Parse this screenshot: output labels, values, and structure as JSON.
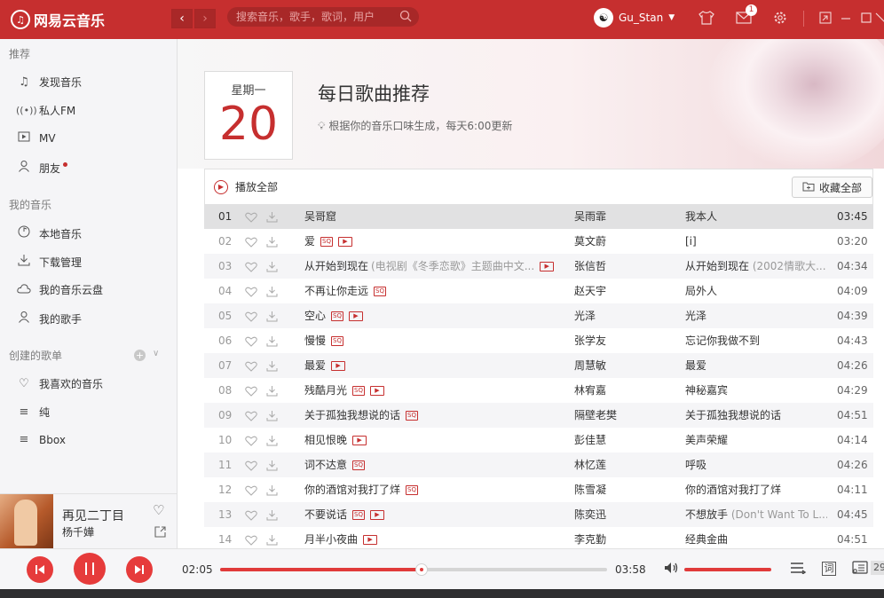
{
  "app": {
    "name": "网易云音乐"
  },
  "search": {
    "placeholder": "搜索音乐，歌手，歌词，用户"
  },
  "user": {
    "name": "Gu_Stan",
    "message_count": "1"
  },
  "sidebar": {
    "sections": [
      {
        "title": "推荐",
        "items": [
          {
            "label": "发现音乐",
            "icon": "music-note-icon"
          },
          {
            "label": "私人FM",
            "icon": "radio-icon"
          },
          {
            "label": "MV",
            "icon": "video-icon"
          },
          {
            "label": "朋友",
            "icon": "friends-icon"
          }
        ]
      },
      {
        "title": "我的音乐",
        "items": [
          {
            "label": "本地音乐",
            "icon": "local-music-icon"
          },
          {
            "label": "下载管理",
            "icon": "download-icon"
          },
          {
            "label": "我的音乐云盘",
            "icon": "cloud-icon"
          },
          {
            "label": "我的歌手",
            "icon": "singer-icon"
          }
        ]
      },
      {
        "title": "创建的歌单",
        "items": [
          {
            "label": "我喜欢的音乐",
            "icon": "heart-icon"
          },
          {
            "label": "纯",
            "icon": "playlist-icon"
          },
          {
            "label": "Bbox",
            "icon": "playlist-icon"
          }
        ]
      }
    ]
  },
  "now_playing": {
    "title": "再见二丁目",
    "artist": "杨千嬅"
  },
  "daily": {
    "weekday": "星期一",
    "day": "20",
    "title": "每日歌曲推荐",
    "subtitle": "根据你的音乐口味生成，每天6:00更新"
  },
  "toolbar": {
    "play_all": "播放全部",
    "collect_all": "收藏全部"
  },
  "tracks": [
    {
      "num": "01",
      "title": "吴哥窟",
      "note": "",
      "sq": false,
      "mv": false,
      "artist": "吴雨霏",
      "album": "我本人",
      "album_note": "",
      "duration": "03:45",
      "selected": true
    },
    {
      "num": "02",
      "title": "爱",
      "note": "",
      "sq": true,
      "mv": true,
      "artist": "莫文蔚",
      "album": "[i]",
      "album_note": "",
      "duration": "03:20"
    },
    {
      "num": "03",
      "title": "从开始到现在",
      "note": "(电视剧《冬季恋歌》主题曲中文...",
      "sq": false,
      "mv": true,
      "artist": "张信哲",
      "album": "从开始到现在",
      "album_note": "(2002情歌大...",
      "duration": "04:34"
    },
    {
      "num": "04",
      "title": "不再让你走远",
      "note": "",
      "sq": true,
      "mv": false,
      "artist": "赵天宇",
      "album": "局外人",
      "album_note": "",
      "duration": "04:09"
    },
    {
      "num": "05",
      "title": "空心",
      "note": "",
      "sq": true,
      "mv": true,
      "artist": "光泽",
      "album": "光泽",
      "album_note": "",
      "duration": "04:39"
    },
    {
      "num": "06",
      "title": "慢慢",
      "note": "",
      "sq": true,
      "mv": false,
      "artist": "张学友",
      "album": "忘记你我做不到",
      "album_note": "",
      "duration": "04:43"
    },
    {
      "num": "07",
      "title": "最爱",
      "note": "",
      "sq": false,
      "mv": true,
      "artist": "周慧敏",
      "album": "最爱",
      "album_note": "",
      "duration": "04:26"
    },
    {
      "num": "08",
      "title": "残酷月光",
      "note": "",
      "sq": true,
      "mv": true,
      "artist": "林宥嘉",
      "album": "神秘嘉宾",
      "album_note": "",
      "duration": "04:29"
    },
    {
      "num": "09",
      "title": "关于孤独我想说的话",
      "note": "",
      "sq": true,
      "mv": false,
      "artist": "隔壁老樊",
      "album": "关于孤独我想说的话",
      "album_note": "",
      "duration": "04:51"
    },
    {
      "num": "10",
      "title": "相见恨晚",
      "note": "",
      "sq": false,
      "mv": true,
      "artist": "彭佳慧",
      "album": "美声荣耀",
      "album_note": "",
      "duration": "04:14"
    },
    {
      "num": "11",
      "title": "词不达意",
      "note": "",
      "sq": true,
      "mv": false,
      "artist": "林忆莲",
      "album": "呼吸",
      "album_note": "",
      "duration": "04:26"
    },
    {
      "num": "12",
      "title": "你的酒馆对我打了烊",
      "note": "",
      "sq": true,
      "mv": false,
      "artist": "陈雪凝",
      "album": "你的酒馆对我打了烊",
      "album_note": "",
      "duration": "04:11"
    },
    {
      "num": "13",
      "title": "不要说话",
      "note": "",
      "sq": true,
      "mv": true,
      "artist": "陈奕迅",
      "album": "不想放手",
      "album_note": "(Don't Want To L...",
      "duration": "04:45"
    },
    {
      "num": "14",
      "title": "月半小夜曲",
      "note": "",
      "sq": false,
      "mv": true,
      "artist": "李克勤",
      "album": "经典金曲",
      "album_note": "",
      "duration": "04:51"
    }
  ],
  "tag_labels": {
    "sq": "SQ",
    "mv": "▶"
  },
  "player": {
    "current_time": "02:05",
    "total_time": "03:58",
    "progress": 0.52,
    "volume": 1.0,
    "lyrics_label": "词",
    "playlist_count": "29"
  },
  "colors": {
    "accent": "#c62f2f"
  }
}
